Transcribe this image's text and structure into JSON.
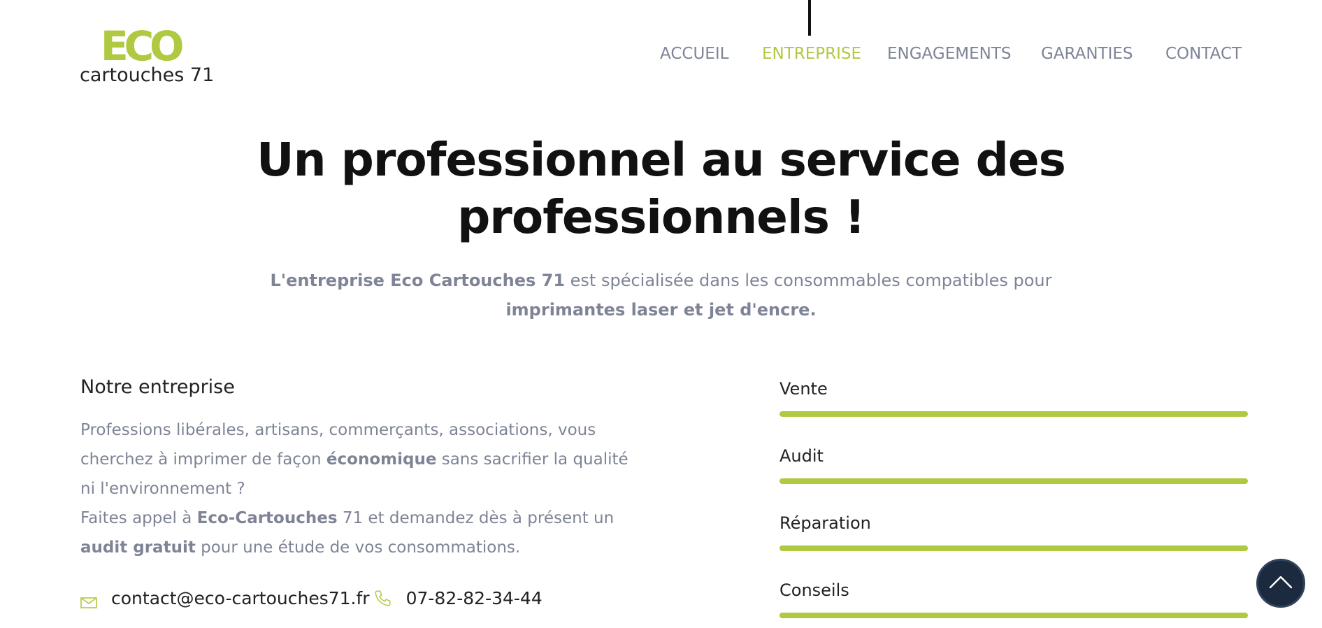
{
  "logo": {
    "eco_text": "ECO",
    "subtitle": "cartouches 71"
  },
  "nav": {
    "items": [
      {
        "label": "ACCUEIL"
      },
      {
        "label": "ENTREPRISE"
      },
      {
        "label": "ENGAGEMENTS"
      },
      {
        "label": "GARANTIES"
      },
      {
        "label": "CONTACT"
      }
    ],
    "active": "ENTREPRISE"
  },
  "hero": {
    "title_line1": "Un professionnel au service des",
    "title_line2": "professionnels !",
    "intro_bold1": "L'entreprise Eco Cartouches 71",
    "intro_text1": " est spécialisée dans les consommables compatibles pour",
    "intro_bold2": "imprimantes laser et jet d'encre."
  },
  "about": {
    "title": "Notre entreprise",
    "line1": "Professions libérales, artisans, commerçants, associations, vous",
    "line2_a": "cherchez à imprimer de façon ",
    "line2_bold": "économique",
    "line2_b": " sans sacrifier la qualité",
    "line3": "ni l'environnement ?",
    "line4_a": "Faites appel à ",
    "line4_bold": "Eco-Cartouches",
    "line4_b": " 71 et demandez dès à présent un",
    "line5_bold": "audit gratuit",
    "line5_b": " pour une étude de vos consommations.",
    "email": "contact@eco-cartouches71.fr",
    "phone": "07-82-82-34-44"
  },
  "skills": [
    {
      "label": "Vente",
      "progress": 1.0
    },
    {
      "label": "Audit",
      "progress": 1.0
    },
    {
      "label": "Réparation",
      "progress": 1.0
    },
    {
      "label": "Conseils",
      "progress": 1.0
    }
  ],
  "icons": {
    "mail": "mail-icon",
    "phone": "phone-icon",
    "scroll_top": "chevron-up-icon"
  },
  "colors": {
    "accent": "#afc941",
    "nav_text": "#7e8496",
    "heading": "#111111",
    "body_text": "#7e8496",
    "scroll_button": "#1b2a3e"
  }
}
